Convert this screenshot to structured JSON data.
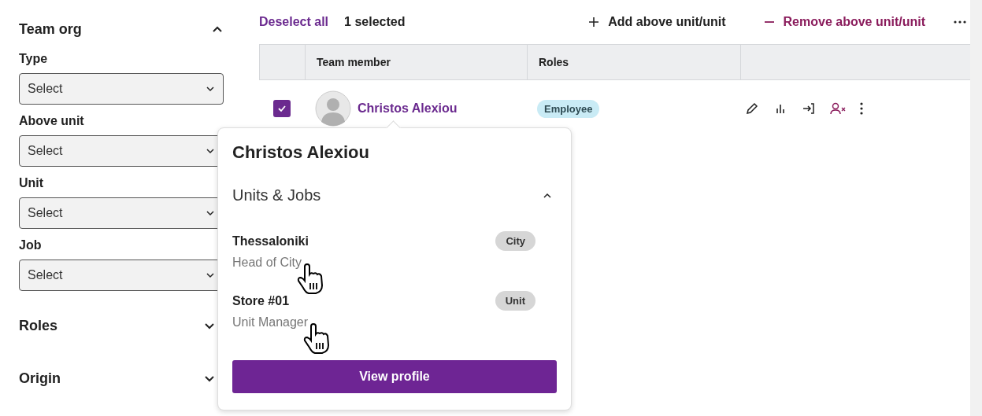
{
  "sidebar": {
    "section": {
      "title": "Team org",
      "expanded": true
    },
    "filters": [
      {
        "label": "Type",
        "placeholder": "Select"
      },
      {
        "label": "Above unit",
        "placeholder": "Select"
      },
      {
        "label": "Unit",
        "placeholder": "Select"
      },
      {
        "label": "Job",
        "placeholder": "Select"
      }
    ],
    "collapsed_sections": [
      {
        "title": "Roles",
        "expanded": false
      },
      {
        "title": "Origin",
        "expanded": false
      }
    ]
  },
  "toolbar": {
    "deselect": "Deselect all",
    "selected_count": "1 selected",
    "add": "Add above unit/unit",
    "remove": "Remove above unit/unit"
  },
  "table": {
    "columns": [
      {
        "label": "Team member"
      },
      {
        "label": "Roles"
      }
    ],
    "rows": [
      {
        "name": "Christos Alexiou",
        "checked": true,
        "role": "Employee"
      }
    ]
  },
  "popover": {
    "title": "Christos Alexiou",
    "section": {
      "title": "Units & Jobs",
      "expanded": true
    },
    "items": [
      {
        "name": "Thessaloniki",
        "tag": "City",
        "job": "Head of City"
      },
      {
        "name": "Store #01",
        "tag": "Unit",
        "job": "Unit Manager"
      }
    ],
    "button": "View profile"
  }
}
